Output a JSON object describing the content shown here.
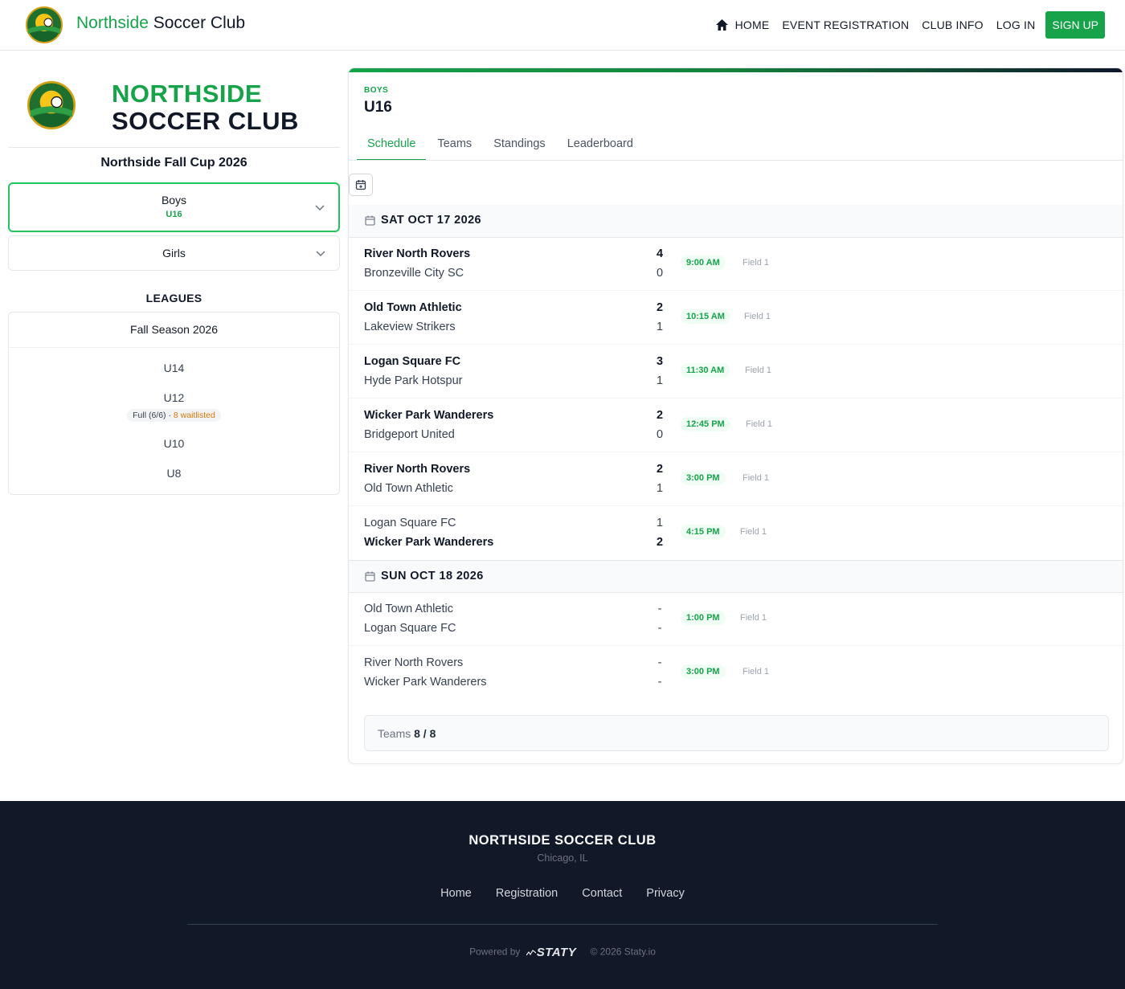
{
  "header": {
    "brand_first": "Northside",
    "brand_rest": " Soccer Club",
    "nav": [
      "HOME",
      "EVENT REGISTRATION",
      "CLUB INFO",
      "LOG IN"
    ],
    "signup": "SIGN UP"
  },
  "sidebar": {
    "title_line1": "NORTHSIDE",
    "title_line2": "SOCCER CLUB",
    "event_name": "Northside Fall Cup 2026",
    "divisions": [
      {
        "name": "Boys",
        "sub": "U16"
      },
      {
        "name": "Girls"
      }
    ],
    "leagues_heading": "LEAGUES",
    "league": {
      "name": "Fall Season 2026",
      "ages": [
        "U14",
        "U12",
        "U10",
        "U8"
      ],
      "u12_status": "Full (6/6)",
      "u12_sep": " · ",
      "u12_waitlist": "8 waitlisted"
    }
  },
  "main": {
    "category": "BOYS",
    "division": "U16",
    "tabs": [
      "Schedule",
      "Teams",
      "Standings",
      "Leaderboard"
    ],
    "days": [
      {
        "date": "SAT OCT 17 2026",
        "matches": [
          {
            "home": "River North Rovers",
            "away": "Bronzeville City SC",
            "home_score": "4",
            "away_score": "0",
            "winner": "home",
            "time": "9:00 AM",
            "field": "Field 1"
          },
          {
            "home": "Old Town Athletic",
            "away": "Lakeview Strikers",
            "home_score": "2",
            "away_score": "1",
            "winner": "home",
            "time": "10:15 AM",
            "field": "Field 1"
          },
          {
            "home": "Logan Square FC",
            "away": "Hyde Park Hotspur",
            "home_score": "3",
            "away_score": "1",
            "winner": "home",
            "time": "11:30 AM",
            "field": "Field 1"
          },
          {
            "home": "Wicker Park Wanderers",
            "away": "Bridgeport United",
            "home_score": "2",
            "away_score": "0",
            "winner": "home",
            "time": "12:45 PM",
            "field": "Field 1"
          },
          {
            "home": "River North Rovers",
            "away": "Old Town Athletic",
            "home_score": "2",
            "away_score": "1",
            "winner": "home",
            "time": "3:00 PM",
            "field": "Field 1"
          },
          {
            "home": "Logan Square FC",
            "away": "Wicker Park Wanderers",
            "home_score": "1",
            "away_score": "2",
            "winner": "away",
            "time": "4:15 PM",
            "field": "Field 1"
          }
        ]
      },
      {
        "date": "SUN OCT 18 2026",
        "matches": [
          {
            "home": "Old Town Athletic",
            "away": "Logan Square FC",
            "home_score": "-",
            "away_score": "-",
            "winner": "none",
            "time": "1:00 PM",
            "field": "Field 1"
          },
          {
            "home": "River North Rovers",
            "away": "Wicker Park Wanderers",
            "home_score": "-",
            "away_score": "-",
            "winner": "none",
            "time": "3:00 PM",
            "field": "Field 1"
          }
        ]
      }
    ],
    "teams_label": "Teams ",
    "teams_value": "8 / 8"
  },
  "footer": {
    "title": "NORTHSIDE SOCCER CLUB",
    "location": "Chicago, IL",
    "links": [
      "Home",
      "Registration",
      "Contact",
      "Privacy"
    ],
    "powered_by": "Powered by",
    "staty": "STATY",
    "copyright": "© 2026 Staty.io"
  },
  "colors": {
    "brand_green": "#16a34a",
    "footer_bg": "#111827",
    "waitlist": "#d97706"
  },
  "icons": {
    "logo": "club-crest-icon",
    "home": "home-icon",
    "chevron": "chevron-down-icon",
    "calendar": "calendar-icon",
    "calendar_add": "calendar-plus-icon"
  }
}
